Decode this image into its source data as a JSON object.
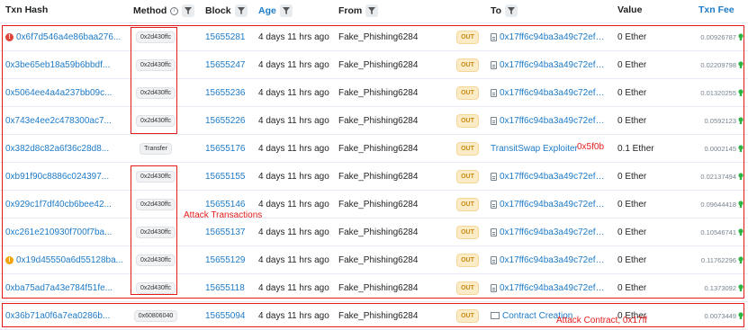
{
  "header": {
    "txn_hash": "Txn Hash",
    "method": "Method",
    "block": "Block",
    "age": "Age",
    "from": "From",
    "to": "To",
    "value": "Value",
    "txn_fee": "Txn Fee"
  },
  "rows": [
    {
      "status": "error",
      "hash": "0x6f7d546a4e86baa276...",
      "method": "0x2d430ffc",
      "block": "15655281",
      "age": "4 days 11 hrs ago",
      "from": "Fake_Phishing6284",
      "dir": "OUT",
      "to": "0x17ff6c94ba3a49c72ef2...",
      "to_icon": "document-icon",
      "value": "0 Ether",
      "fee": "0.00926787"
    },
    {
      "status": "",
      "hash": "0x3be65eb18a59b6bbdf...",
      "method": "0x2d430ffc",
      "block": "15655247",
      "age": "4 days 11 hrs ago",
      "from": "Fake_Phishing6284",
      "dir": "OUT",
      "to": "0x17ff6c94ba3a49c72ef2...",
      "to_icon": "document-icon",
      "value": "0 Ether",
      "fee": "0.02209798"
    },
    {
      "status": "",
      "hash": "0x5064ee4a4a237bb09c...",
      "method": "0x2d430ffc",
      "block": "15655236",
      "age": "4 days 11 hrs ago",
      "from": "Fake_Phishing6284",
      "dir": "OUT",
      "to": "0x17ff6c94ba3a49c72ef2...",
      "to_icon": "document-icon",
      "value": "0 Ether",
      "fee": "0.01320255"
    },
    {
      "status": "",
      "hash": "0x743e4ee2c478300ac7...",
      "method": "0x2d430ffc",
      "block": "15655226",
      "age": "4 days 11 hrs ago",
      "from": "Fake_Phishing6284",
      "dir": "OUT",
      "to": "0x17ff6c94ba3a49c72ef2...",
      "to_icon": "document-icon",
      "value": "0 Ether",
      "fee": "0.0592123"
    },
    {
      "status": "",
      "hash": "0x382d8c82a6f36c28d8...",
      "method": "Transfer",
      "block": "15655176",
      "age": "4 days 11 hrs ago",
      "from": "Fake_Phishing6284",
      "dir": "OUT",
      "to": "TransitSwap Exploiter",
      "to_icon": "",
      "value": "0.1 Ether",
      "fee": "0.0002145"
    },
    {
      "status": "",
      "hash": "0xb91f90c8886c024397...",
      "method": "0x2d430ffc",
      "block": "15655155",
      "age": "4 days 11 hrs ago",
      "from": "Fake_Phishing6284",
      "dir": "OUT",
      "to": "0x17ff6c94ba3a49c72ef2...",
      "to_icon": "document-icon",
      "value": "0 Ether",
      "fee": "0.02137494"
    },
    {
      "status": "",
      "hash": "0x929c1f7df40cb6bee42...",
      "method": "0x2d430ffc",
      "block": "15655146",
      "age": "4 days 11 hrs ago",
      "from": "Fake_Phishing6284",
      "dir": "OUT",
      "to": "0x17ff6c94ba3a49c72ef2...",
      "to_icon": "document-icon",
      "value": "0 Ether",
      "fee": "0.09644418"
    },
    {
      "status": "",
      "hash": "0xc261e210930f700f7ba...",
      "method": "0x2d430ffc",
      "block": "15655137",
      "age": "4 days 11 hrs ago",
      "from": "Fake_Phishing6284",
      "dir": "OUT",
      "to": "0x17ff6c94ba3a49c72ef2...",
      "to_icon": "document-icon",
      "value": "0 Ether",
      "fee": "0.10546741"
    },
    {
      "status": "warning",
      "hash": "0x19d45550a6d55128ba...",
      "method": "0x2d430ffc",
      "block": "15655129",
      "age": "4 days 11 hrs ago",
      "from": "Fake_Phishing6284",
      "dir": "OUT",
      "to": "0x17ff6c94ba3a49c72ef2...",
      "to_icon": "document-icon",
      "value": "0 Ether",
      "fee": "0.11762296"
    },
    {
      "status": "",
      "hash": "0xba75ad7a43e784f51fe...",
      "method": "0x2d430ffc",
      "block": "15655118",
      "age": "4 days 11 hrs ago",
      "from": "Fake_Phishing6284",
      "dir": "OUT",
      "to": "0x17ff6c94ba3a49c72ef2...",
      "to_icon": "document-icon",
      "value": "0 Ether",
      "fee": "0.1373092"
    },
    {
      "status": "",
      "hash": "0x36b71a0f6a7ea0286b...",
      "method": "0x60806040",
      "block": "15655094",
      "age": "4 days 11 hrs ago",
      "from": "Fake_Phishing6284",
      "dir": "OUT",
      "to": "Contract Creation",
      "to_icon": "contract-icon",
      "value": "0 Ether",
      "fee": "0.0073449"
    }
  ],
  "annotations": {
    "exploiter_tag": "0x5f0b",
    "attack_transactions": "Attack Transactions",
    "attack_contract": "Attack Contract, 0x17ff"
  },
  "colors": {
    "link": "#1e7bc8",
    "annotation_red": "#e51b1b",
    "out_badge_bg": "#fbecc7",
    "fee_icon_green": "#2fb344"
  }
}
